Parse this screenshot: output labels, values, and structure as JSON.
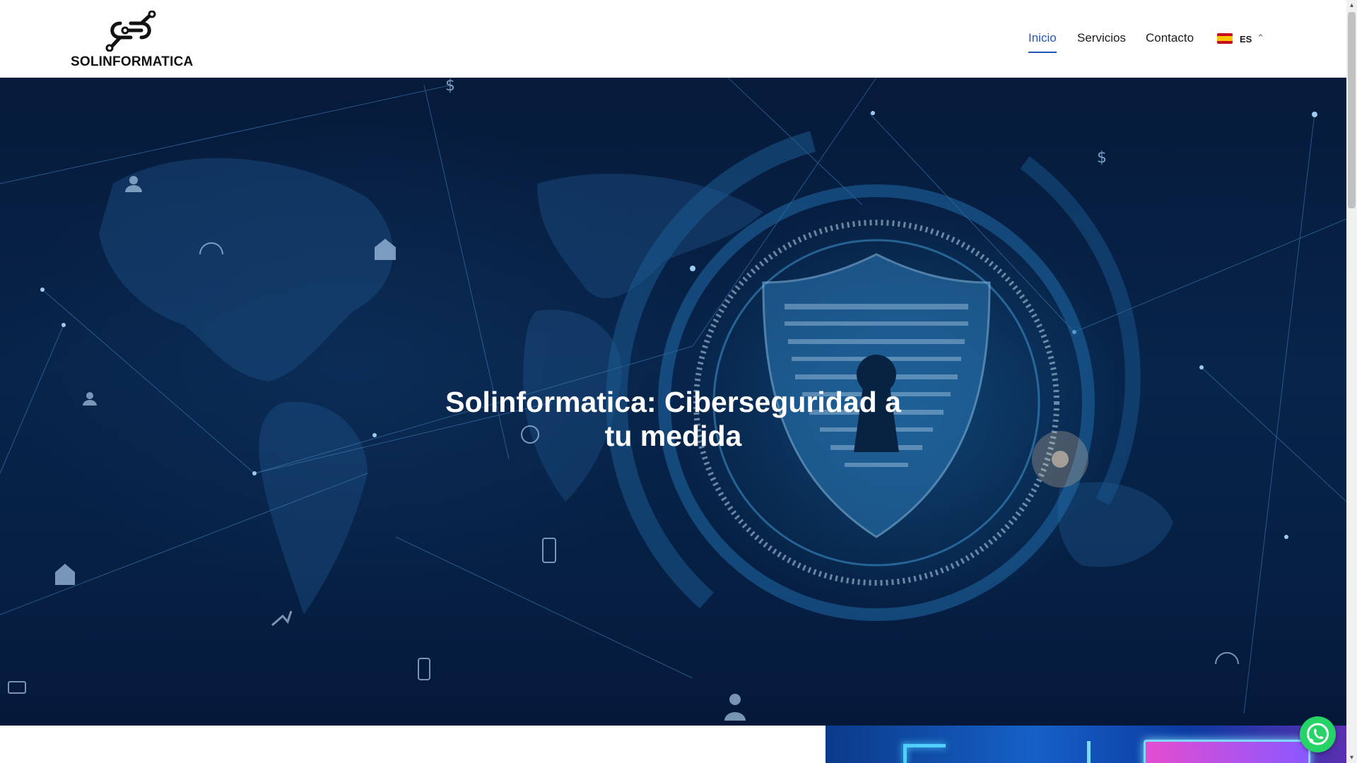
{
  "brand": {
    "name": "SOLINFORMATICA"
  },
  "nav": {
    "items": [
      {
        "label": "Inicio",
        "active": true
      },
      {
        "label": "Servicios",
        "active": false
      },
      {
        "label": "Contacto",
        "active": false
      }
    ],
    "language": {
      "code": "ES",
      "flag_icon": "spain-flag-icon"
    }
  },
  "hero": {
    "title": "Solinformatica: Ciberseguridad a tu medida"
  },
  "colors": {
    "accent": "#1f56b7",
    "hero_bg": "#07244a",
    "whatsapp": "#25d366"
  }
}
